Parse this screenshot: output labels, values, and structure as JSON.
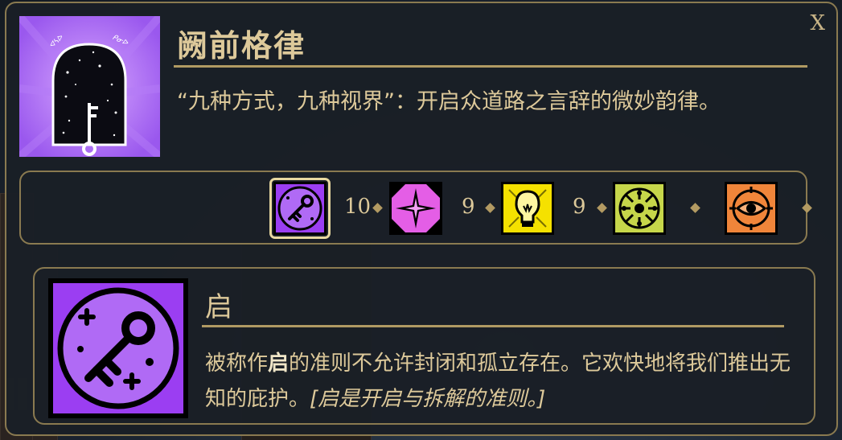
{
  "header": {
    "title": "阙前格律",
    "close_label": "X",
    "quote": "“九种方式，九种视界”：开启众道路之言辞的微妙韵律。"
  },
  "portrait": {
    "icon": "key-in-arch-icon",
    "colors": {
      "bg": "#a466f0",
      "arch": "#0b0b12"
    }
  },
  "aspects": [
    {
      "name": "启",
      "icon": "key-icon",
      "value": "10",
      "color": "#9b3ef2",
      "selected": true
    },
    {
      "name": "star-aspect",
      "icon": "star-icon",
      "value": "9",
      "color": "#e45ee6",
      "selected": false
    },
    {
      "name": "lightbulb-aspect",
      "icon": "lightbulb-icon",
      "value": "9",
      "color": "#f5e100",
      "selected": false
    },
    {
      "name": "sun-aspect",
      "icon": "sun-rune-icon",
      "value": "",
      "color": "#c6d64a",
      "selected": false
    },
    {
      "name": "eye-aspect",
      "icon": "eye-icon",
      "value": "",
      "color": "#f0853a",
      "selected": false
    }
  ],
  "detail": {
    "title": "启",
    "text_prefix": "被称作",
    "text_bold": "启",
    "text_mid": "的准则不允许封闭和孤立存在。它欢快地将我们推出无知的庇护。",
    "text_italic": "[启是开启与拆解的准则。]"
  }
}
